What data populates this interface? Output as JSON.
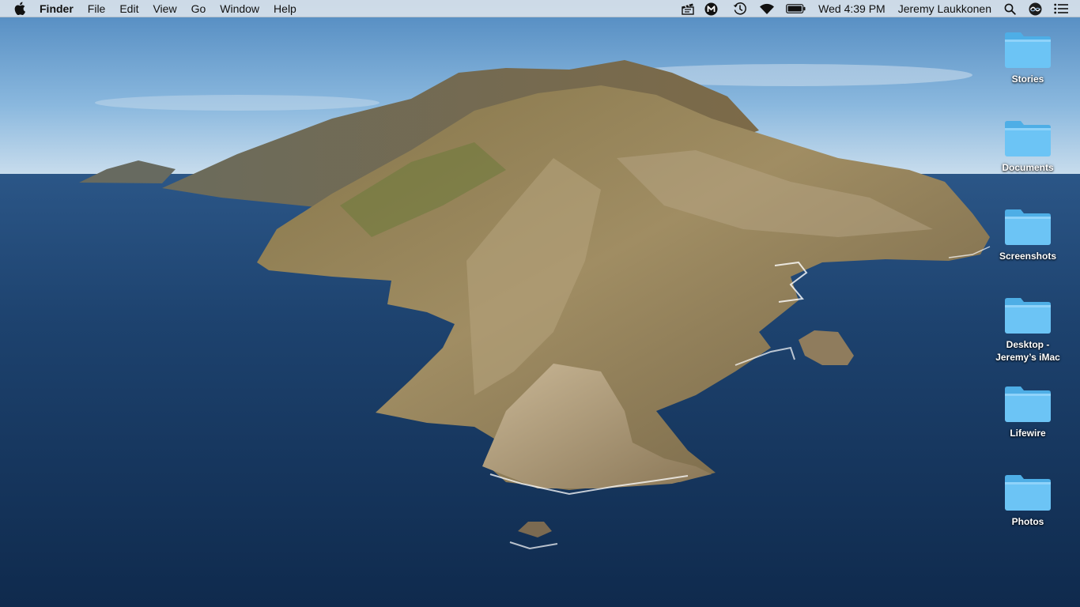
{
  "menubar": {
    "apple_icon": "apple-logo-icon",
    "app_name": "Finder",
    "menus": [
      "File",
      "Edit",
      "View",
      "Go",
      "Window",
      "Help"
    ],
    "status_icons": [
      "clapperboard-icon",
      "malwarebytes-icon",
      "time-machine-icon",
      "wifi-icon",
      "battery-icon"
    ],
    "clock": "Wed 4:39 PM",
    "user_name": "Jeremy Laukkonen",
    "spotlight_icon": "spotlight-search-icon",
    "siri_icon": "siri-icon",
    "notification_icon": "notification-center-icon"
  },
  "desktop": {
    "folders": [
      {
        "label": "Stories"
      },
      {
        "label": "Documents"
      },
      {
        "label": "Screenshots"
      },
      {
        "label_line1": "Desktop -",
        "label_line2": "Jeremy’s iMac"
      },
      {
        "label": "Lifewire"
      },
      {
        "label": "Photos"
      }
    ]
  },
  "colors": {
    "folder_body": "#69c3f4",
    "folder_tab": "#55b1e6",
    "sky": "#7fb1da",
    "ocean": "#17375e",
    "land": "#7a6b4a"
  }
}
